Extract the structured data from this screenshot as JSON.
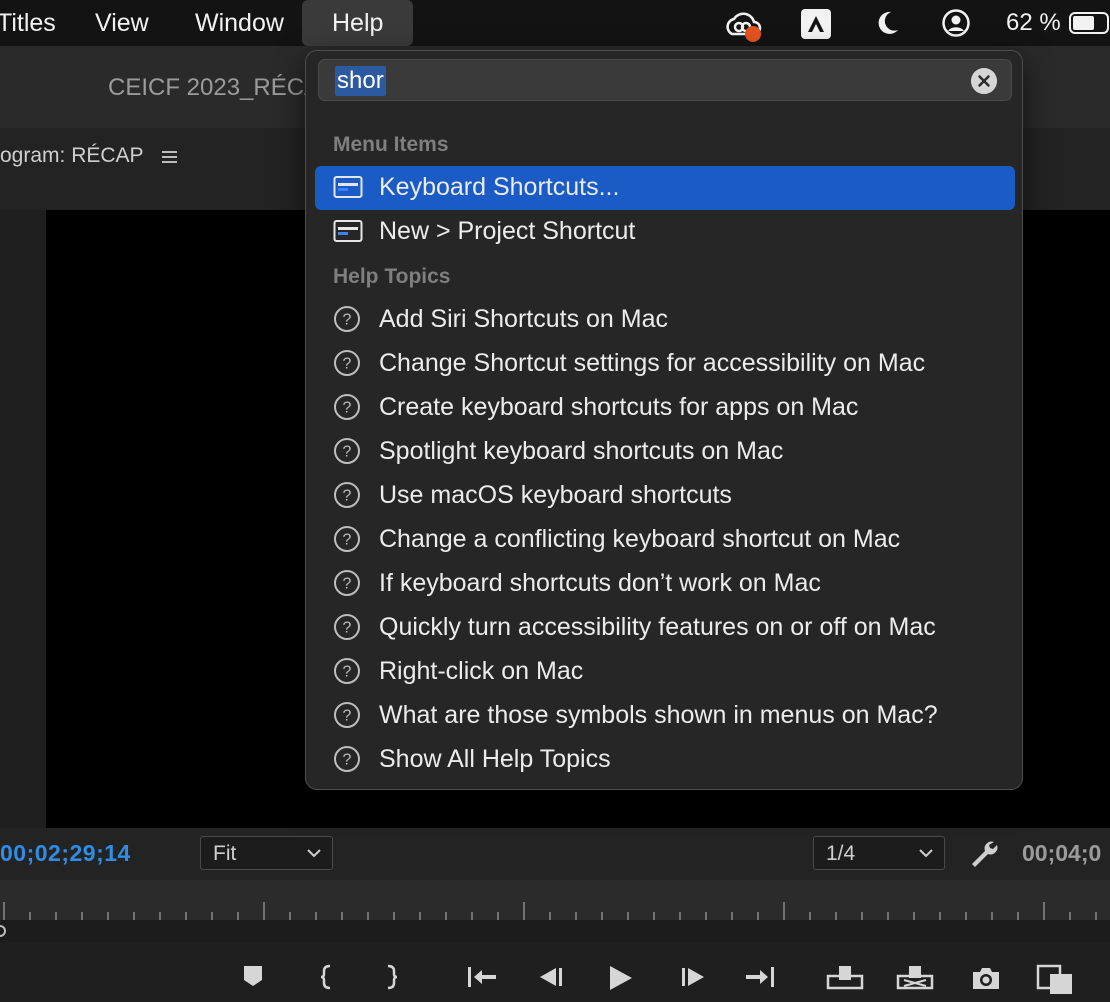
{
  "menubar": {
    "items": [
      "Titles",
      "View",
      "Window",
      "Help"
    ],
    "battery": "62 %"
  },
  "app": {
    "tab_title": "CEICF 2023_RÉC/",
    "program_label": "ogram: RÉCAP",
    "timecode_left": "00;02;29;14",
    "fit_value": "Fit",
    "resolution_value": "1/4",
    "timecode_right": "00;04;0"
  },
  "help_menu": {
    "search_value": "shor",
    "menu_items_header": "Menu Items",
    "menu_items": [
      {
        "label": "Keyboard Shortcuts...",
        "selected": true
      },
      {
        "label": "New > Project Shortcut",
        "selected": false
      }
    ],
    "help_topics_header": "Help Topics",
    "help_topics": [
      "Add Siri Shortcuts on Mac",
      "Change Shortcut settings for accessibility on Mac",
      "Create keyboard shortcuts for apps on Mac",
      "Spotlight keyboard shortcuts on Mac",
      "Use macOS keyboard shortcuts",
      "Change a conflicting keyboard shortcut on Mac",
      "If keyboard shortcuts don’t work on Mac",
      "Quickly turn accessibility features on or off on Mac",
      "Right-click on Mac",
      "What are those symbols shown in menus on Mac?",
      "Show All Help Topics"
    ]
  },
  "colors": {
    "accent_selected": "#1b5bc6",
    "timecode_blue": "#2f8de4"
  }
}
